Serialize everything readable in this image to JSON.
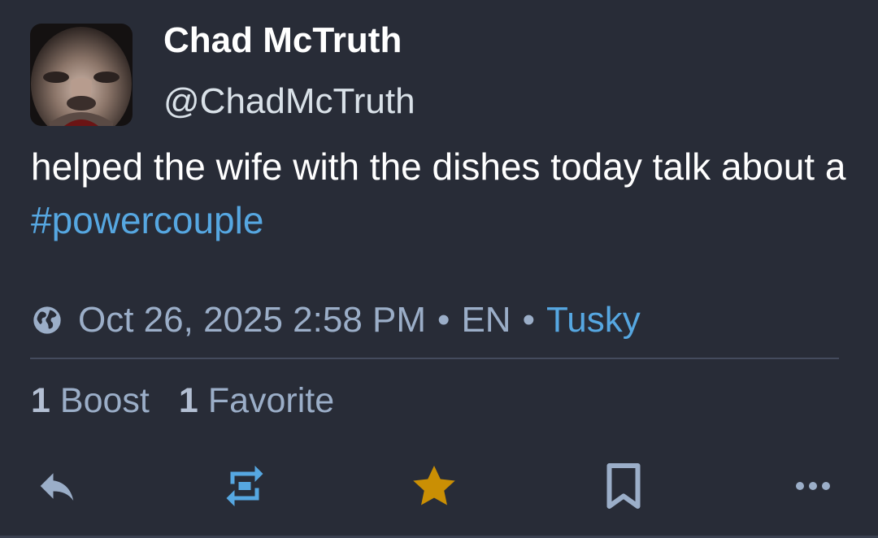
{
  "author": {
    "display_name": "Chad McTruth",
    "username": "@ChadMcTruth"
  },
  "content": {
    "text": "helped the wife with the dishes today talk about a ",
    "hashtag": "#powercouple"
  },
  "meta": {
    "timestamp": "Oct 26, 2025 2:58 PM",
    "separator": "•",
    "language": "EN",
    "application": "Tusky",
    "visibility_icon": "globe-icon"
  },
  "stats": {
    "boost_count": "1",
    "boost_label": "Boost",
    "favorite_count": "1",
    "favorite_label": "Favorite"
  },
  "actions": {
    "reply_icon": "reply-icon",
    "boost_icon": "boost-icon",
    "favorite_icon": "star-icon",
    "bookmark_icon": "bookmark-icon",
    "more_icon": "more-icon"
  },
  "colors": {
    "background": "#282c37",
    "link": "#56a7e1",
    "muted": "#9baec8",
    "favorite_active": "#ca8f04"
  }
}
